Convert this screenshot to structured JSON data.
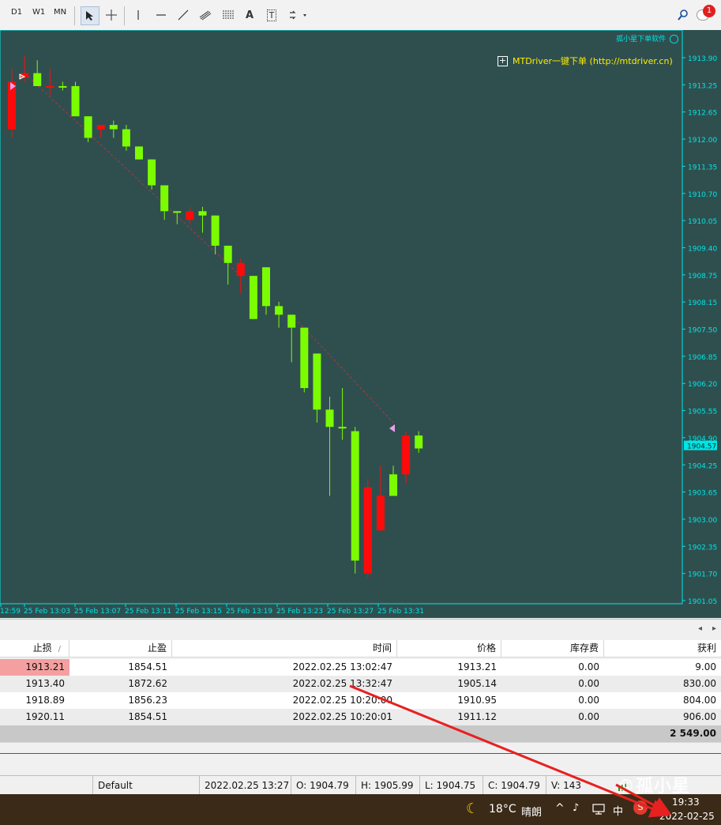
{
  "toolbar": {
    "timeframes": [
      "D1",
      "W1",
      "MN"
    ],
    "draw_labels": {
      "text_tool": "A",
      "text_label_tool": "T"
    },
    "notification_count": "1"
  },
  "chart": {
    "credit": "孤小星下单软件",
    "banner": "MTDriver一键下单 (http://mtdriver.cn)",
    "current_price": "1904.57",
    "price_labels": [
      "1913.90",
      "1913.25",
      "1912.65",
      "1912.00",
      "1911.35",
      "1910.70",
      "1910.05",
      "1909.40",
      "1908.75",
      "1908.15",
      "1907.50",
      "1906.85",
      "1906.20",
      "1905.55",
      "1904.90",
      "1904.25",
      "1903.65",
      "1903.00",
      "1902.35",
      "1901.70",
      "1901.05"
    ],
    "time_labels": [
      "12:59",
      "25 Feb 13:03",
      "25 Feb 13:07",
      "25 Feb 13:11",
      "25 Feb 13:15",
      "25 Feb 13:19",
      "25 Feb 13:23",
      "25 Feb 13:27",
      "25 Feb 13:31"
    ],
    "colors": {
      "background": "#2f4f4f",
      "bull": "#7cfc00",
      "bear": "#ff0a0a",
      "axis": "#00e5e5"
    }
  },
  "chart_data": {
    "type": "candlestick",
    "x": [
      "13:00",
      "13:01",
      "13:02",
      "13:03",
      "13:04",
      "13:05",
      "13:06",
      "13:07",
      "13:08",
      "13:09",
      "13:10",
      "13:11",
      "13:12",
      "13:13",
      "13:14",
      "13:15",
      "13:16",
      "13:17",
      "13:18",
      "13:19",
      "13:20",
      "13:21",
      "13:22",
      "13:23",
      "13:24",
      "13:25",
      "13:26",
      "13:27",
      "13:28",
      "13:29",
      "13:30",
      "13:31",
      "13:32"
    ],
    "open": [
      1911.9,
      1913.1,
      1913.2,
      1912.9,
      1912.9,
      1912.9,
      1912.2,
      1911.9,
      1912.0,
      1911.9,
      1911.5,
      1911.2,
      1910.6,
      1910.0,
      1910.0,
      1910.0,
      1909.9,
      1909.2,
      1908.8,
      1908.5,
      1908.7,
      1907.8,
      1907.6,
      1907.3,
      1906.7,
      1905.4,
      1905.0,
      1904.9,
      1901.6,
      1902.6,
      1903.4,
      1903.9,
      1904.8
    ],
    "high": [
      1913.3,
      1913.6,
      1913.5,
      1913.3,
      1913.0,
      1913.0,
      1912.2,
      1911.9,
      1912.1,
      1912.0,
      1911.5,
      1911.2,
      1910.6,
      1910.0,
      1910.1,
      1910.1,
      1909.9,
      1909.2,
      1908.9,
      1908.5,
      1908.7,
      1907.9,
      1907.6,
      1907.3,
      1906.7,
      1905.7,
      1905.9,
      1905.0,
      1903.8,
      1904.1,
      1904.1,
      1904.9,
      1904.9
    ],
    "low": [
      1911.7,
      1913.0,
      1912.9,
      1912.7,
      1912.8,
      1912.2,
      1911.6,
      1911.7,
      1911.7,
      1911.4,
      1911.2,
      1910.5,
      1909.8,
      1909.7,
      1909.7,
      1909.5,
      1909.0,
      1908.3,
      1908.1,
      1907.5,
      1907.6,
      1907.3,
      1906.5,
      1905.8,
      1905.1,
      1903.4,
      1904.7,
      1901.6,
      1901.5,
      1902.6,
      1903.4,
      1903.7,
      1904.4
    ],
    "close": [
      1913.0,
      1913.2,
      1912.9,
      1912.9,
      1912.9,
      1912.2,
      1911.7,
      1912.0,
      1911.9,
      1911.5,
      1911.2,
      1910.6,
      1910.0,
      1910.0,
      1909.8,
      1909.9,
      1909.2,
      1908.8,
      1908.5,
      1907.5,
      1907.8,
      1907.6,
      1907.3,
      1905.9,
      1905.4,
      1905.0,
      1905.0,
      1901.9,
      1903.6,
      1903.4,
      1903.9,
      1904.8,
      1904.5
    ],
    "bearish": [
      true,
      true,
      false,
      true,
      false,
      false,
      false,
      true,
      false,
      false,
      false,
      false,
      false,
      false,
      true,
      false,
      false,
      false,
      true,
      false,
      false,
      false,
      false,
      false,
      false,
      false,
      false,
      false,
      true,
      true,
      false,
      true,
      false
    ],
    "ylim": [
      1900.9,
      1914.2
    ]
  },
  "table": {
    "headers": [
      "止损",
      "止盈",
      "时间",
      "价格",
      "库存费",
      "获利"
    ],
    "rows": [
      [
        "1913.21",
        "1854.51",
        "2022.02.25 13:02:47",
        "1913.21",
        "0.00",
        "9.00"
      ],
      [
        "1913.40",
        "1872.62",
        "2022.02.25 13:32:47",
        "1905.14",
        "0.00",
        "830.00"
      ],
      [
        "1918.89",
        "1856.23",
        "2022.02.25 10:20:00",
        "1910.95",
        "0.00",
        "804.00"
      ],
      [
        "1920.11",
        "1854.51",
        "2022.02.25 10:20:01",
        "1911.12",
        "0.00",
        "906.00"
      ]
    ],
    "total": "2 549.00"
  },
  "status": {
    "profile": "Default",
    "datetime": "2022.02.25 13:27",
    "open": "O: 1904.79",
    "high": "H: 1905.99",
    "low": "L: 1904.75",
    "close": "C: 1904.79",
    "volume": "V: 143"
  },
  "taskbar": {
    "weather_temp": "18°C",
    "weather_text": "晴朗",
    "ime": "中",
    "time": "19:33",
    "date": "2022-02-25",
    "watermark": "©孤小星"
  }
}
